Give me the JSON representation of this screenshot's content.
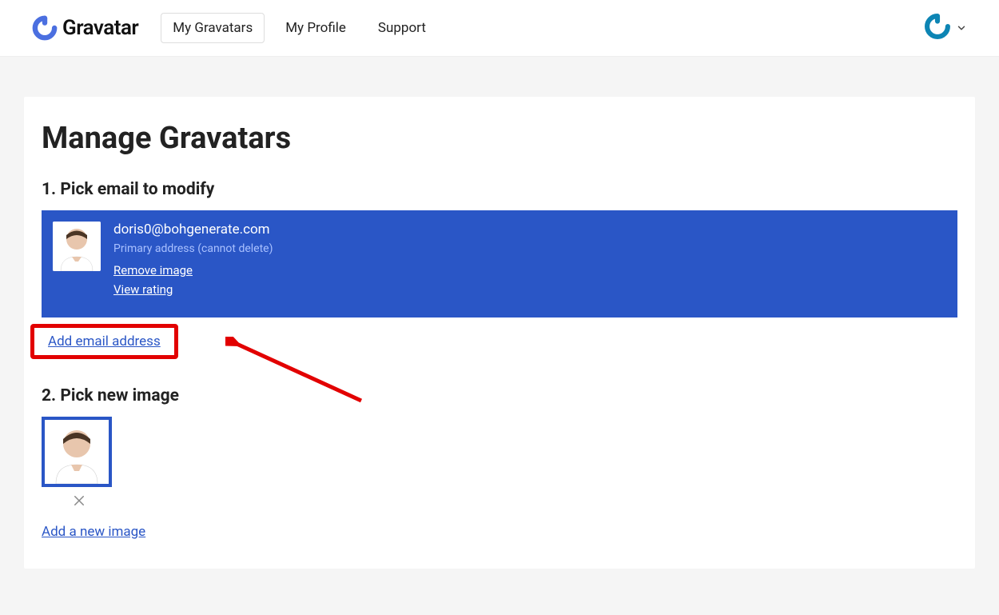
{
  "header": {
    "brand": "Gravatar",
    "nav": {
      "my_gravatars": "My Gravatars",
      "my_profile": "My Profile",
      "support": "Support"
    }
  },
  "page": {
    "title": "Manage Gravatars",
    "step1": {
      "heading": "1. Pick email to modify",
      "email": "doris0@bohgenerate.com",
      "primary_note": "Primary address (cannot delete)",
      "remove_image": "Remove image",
      "view_rating": "View rating",
      "add_email_link": "Add email address"
    },
    "step2": {
      "heading": "2. Pick new image",
      "add_image": "Add a new image"
    }
  }
}
